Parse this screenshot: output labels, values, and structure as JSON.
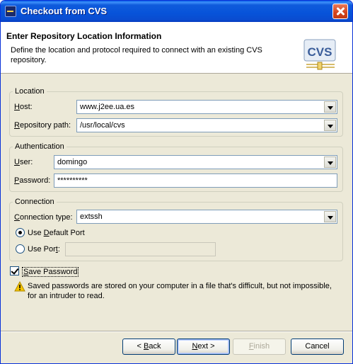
{
  "window": {
    "title": "Checkout from CVS"
  },
  "banner": {
    "title": "Enter Repository Location Information",
    "description": "Define the location and protocol required to connect with an existing CVS repository.",
    "logo_text": "CVS"
  },
  "location": {
    "legend": "Location",
    "host_label_mnemonic": "H",
    "host_label_rest": "ost:",
    "host_value": "www.j2ee.ua.es",
    "path_label_mnemonic": "R",
    "path_label_rest": "epository path:",
    "path_value": "/usr/local/cvs"
  },
  "authentication": {
    "legend": "Authentication",
    "user_label_mnemonic": "U",
    "user_label_rest": "ser:",
    "user_value": "domingo",
    "password_label_mnemonic": "P",
    "password_label_rest": "assword:",
    "password_value": "**********"
  },
  "connection": {
    "legend": "Connection",
    "type_label_mnemonic": "C",
    "type_label_rest": "onnection type:",
    "type_value": "extssh",
    "default_port_label_pre": "Use ",
    "default_port_label_mnemonic": "D",
    "default_port_label_rest": "efault Port",
    "default_port_selected": true,
    "use_port_label_pre": "Use Por",
    "use_port_label_mnemonic": "t",
    "use_port_label_rest": ":",
    "use_port_value": ""
  },
  "save_password": {
    "label_mnemonic": "S",
    "label_rest": "ave Password",
    "checked": true,
    "warning": "Saved passwords are stored on your computer in a file that's difficult, but not impossible, for an intruder to read."
  },
  "buttons": {
    "back_pre": "< ",
    "back_mnemonic": "B",
    "back_rest": "ack",
    "next_mnemonic": "N",
    "next_rest": "ext >",
    "finish_mnemonic": "F",
    "finish_rest": "inish",
    "cancel": "Cancel"
  },
  "colors": {
    "titlebar": "#0753d9",
    "dialog_bg": "#ece9d8",
    "field_border": "#7f9db9",
    "warning_yellow": "#f5c400"
  },
  "icons": {
    "title": "eclipse-icon",
    "close": "close-icon",
    "logo": "cvs-logo",
    "warning": "warning-icon"
  }
}
